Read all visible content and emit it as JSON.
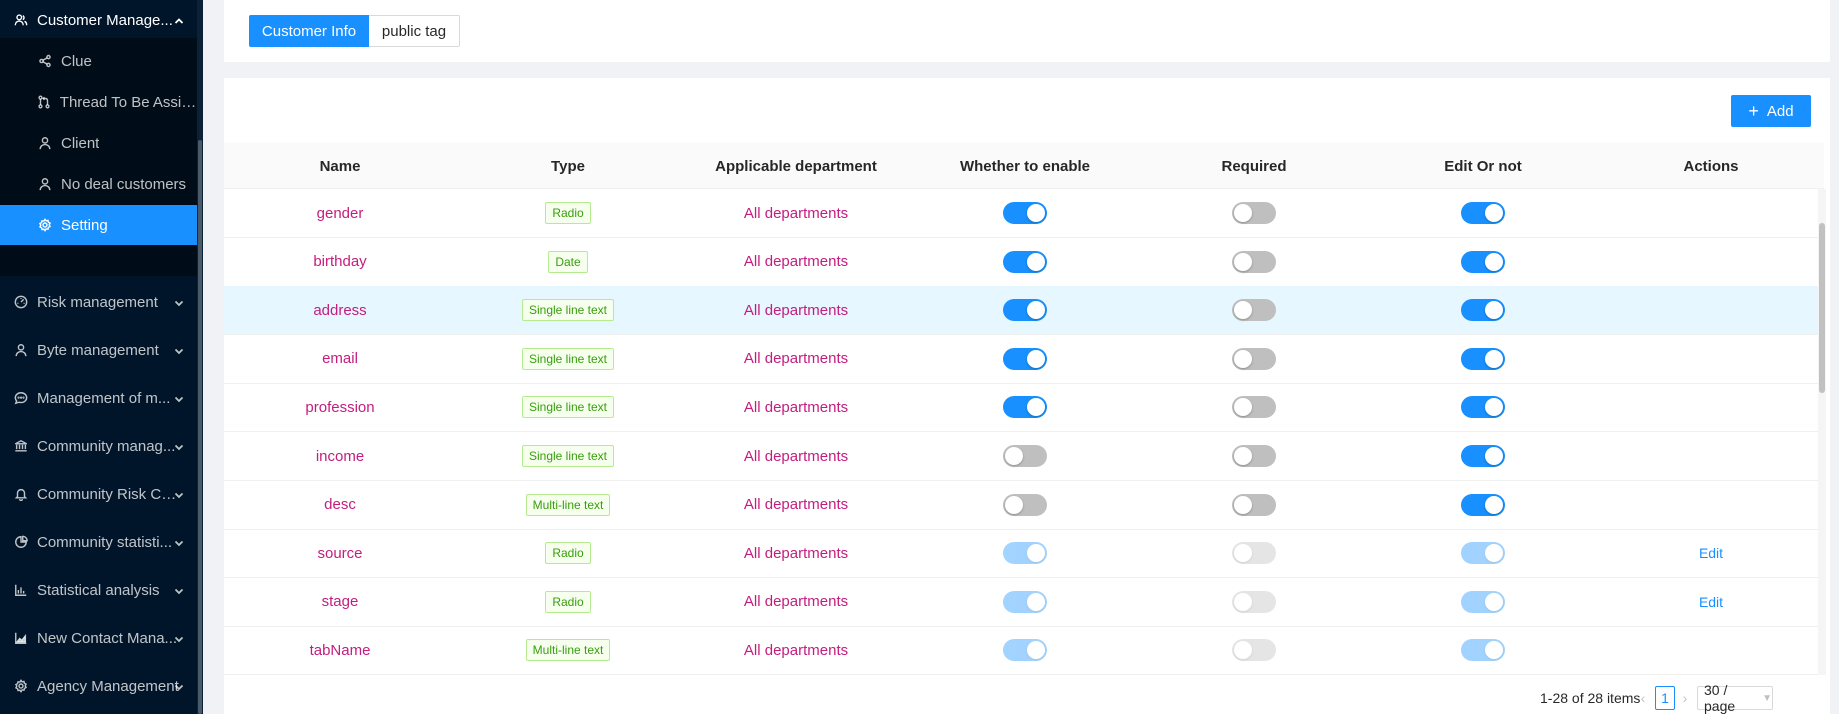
{
  "sidebar": {
    "parent": {
      "label": "Customer Manage...",
      "icon": "team-icon"
    },
    "children": [
      {
        "label": "Clue",
        "icon": "share-icon",
        "active": false
      },
      {
        "label": "Thread To Be Assigned",
        "icon": "branch-icon",
        "active": false
      },
      {
        "label": "Client",
        "icon": "user-icon",
        "active": false
      },
      {
        "label": "No deal customers",
        "icon": "user-icon",
        "active": false
      },
      {
        "label": "Setting",
        "icon": "gear-icon",
        "active": true
      }
    ],
    "items": [
      {
        "label": "Risk management",
        "icon": "dashboard-icon"
      },
      {
        "label": "Byte management",
        "icon": "user-icon"
      },
      {
        "label": "Management of m...",
        "icon": "message-icon"
      },
      {
        "label": "Community manag...",
        "icon": "bank-icon"
      },
      {
        "label": "Community Risk Co...",
        "icon": "bell-icon"
      },
      {
        "label": "Community statisti...",
        "icon": "pie-chart-icon"
      },
      {
        "label": "Statistical analysis",
        "icon": "bar-chart-icon"
      },
      {
        "label": "New Contact Mana...",
        "icon": "area-chart-icon"
      },
      {
        "label": "Agency Management",
        "icon": "gear-icon"
      }
    ]
  },
  "tabs": {
    "active": "Customer Info",
    "other": "public tag"
  },
  "toolbar": {
    "add_label": "Add"
  },
  "table": {
    "columns": [
      "Name",
      "Type",
      "Applicable department",
      "Whether to enable",
      "Required",
      "Edit Or not",
      "Actions"
    ],
    "rows": [
      {
        "name": "gender",
        "type": "Radio",
        "dept": "All departments",
        "enable": true,
        "required": false,
        "editable": true,
        "disabled": false,
        "action": ""
      },
      {
        "name": "birthday",
        "type": "Date",
        "dept": "All departments",
        "enable": true,
        "required": false,
        "editable": true,
        "disabled": false,
        "action": ""
      },
      {
        "name": "address",
        "type": "Single line text",
        "dept": "All departments",
        "enable": true,
        "required": false,
        "editable": true,
        "disabled": false,
        "action": ""
      },
      {
        "name": "email",
        "type": "Single line text",
        "dept": "All departments",
        "enable": true,
        "required": false,
        "editable": true,
        "disabled": false,
        "action": ""
      },
      {
        "name": "profession",
        "type": "Single line text",
        "dept": "All departments",
        "enable": true,
        "required": false,
        "editable": true,
        "disabled": false,
        "action": ""
      },
      {
        "name": "income",
        "type": "Single line text",
        "dept": "All departments",
        "enable": false,
        "required": false,
        "editable": true,
        "disabled": false,
        "action": ""
      },
      {
        "name": "desc",
        "type": "Multi-line text",
        "dept": "All departments",
        "enable": false,
        "required": false,
        "editable": true,
        "disabled": false,
        "action": ""
      },
      {
        "name": "source",
        "type": "Radio",
        "dept": "All departments",
        "enable": true,
        "required": false,
        "editable": true,
        "disabled": true,
        "action": "Edit"
      },
      {
        "name": "stage",
        "type": "Radio",
        "dept": "All departments",
        "enable": true,
        "required": false,
        "editable": true,
        "disabled": true,
        "action": "Edit"
      },
      {
        "name": "tabName",
        "type": "Multi-line text",
        "dept": "All departments",
        "enable": true,
        "required": false,
        "editable": true,
        "disabled": true,
        "action": ""
      }
    ]
  },
  "pagination": {
    "total": "1-28 of 28 items",
    "current": "1",
    "page_size": "30 / page"
  }
}
